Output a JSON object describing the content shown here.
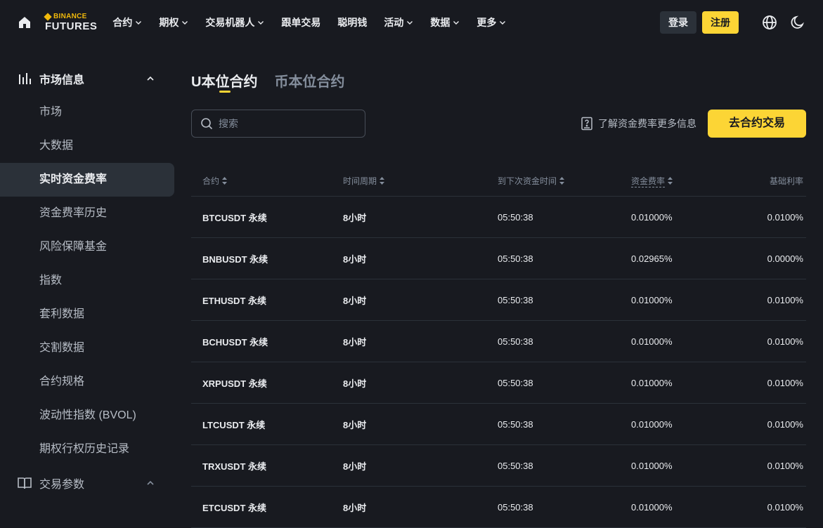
{
  "header": {
    "logo_top": "BINANCE",
    "logo_bottom": "FUTURES",
    "nav": [
      {
        "label": "合约",
        "dropdown": true
      },
      {
        "label": "期权",
        "dropdown": true
      },
      {
        "label": "交易机器人",
        "dropdown": true
      },
      {
        "label": "跟单交易",
        "dropdown": false
      },
      {
        "label": "聪明钱",
        "dropdown": false
      },
      {
        "label": "活动",
        "dropdown": true
      },
      {
        "label": "数据",
        "dropdown": true
      },
      {
        "label": "更多",
        "dropdown": true
      }
    ],
    "login_label": "登录",
    "register_label": "注册"
  },
  "sidebar": {
    "section1": "市场信息",
    "items": [
      "市场",
      "大数据",
      "实时资金费率",
      "资金费率历史",
      "风险保障基金",
      "指数",
      "套利数据",
      "交割数据",
      "合约规格",
      "波动性指数 (BVOL)",
      "期权行权历史记录"
    ],
    "active_index": 2,
    "section2": "交易参数"
  },
  "main": {
    "tabs": [
      "U本位合约",
      "币本位合约"
    ],
    "search_placeholder": "搜索",
    "info_link": "了解资金费率更多信息",
    "trade_button": "去合约交易",
    "columns": [
      "合约",
      "时间周期",
      "到下次资金时间",
      "资金费率",
      "基础利率"
    ],
    "rows": [
      [
        "BTCUSDT 永续",
        "8小时",
        "05:50:38",
        "0.01000%",
        "0.0100%"
      ],
      [
        "BNBUSDT 永续",
        "8小时",
        "05:50:38",
        "0.02965%",
        "0.0000%"
      ],
      [
        "ETHUSDT 永续",
        "8小时",
        "05:50:38",
        "0.01000%",
        "0.0100%"
      ],
      [
        "BCHUSDT 永续",
        "8小时",
        "05:50:38",
        "0.01000%",
        "0.0100%"
      ],
      [
        "XRPUSDT 永续",
        "8小时",
        "05:50:38",
        "0.01000%",
        "0.0100%"
      ],
      [
        "LTCUSDT 永续",
        "8小时",
        "05:50:38",
        "0.01000%",
        "0.0100%"
      ],
      [
        "TRXUSDT 永续",
        "8小时",
        "05:50:38",
        "0.01000%",
        "0.0100%"
      ],
      [
        "ETCUSDT 永续",
        "8小时",
        "05:50:38",
        "0.01000%",
        "0.0100%"
      ]
    ]
  },
  "colors": {
    "accent": "#fcd535",
    "background": "#181a20",
    "surface": "#2b3139",
    "muted": "#848e9c"
  },
  "icons": {
    "home": "home-icon",
    "globe": "globe-icon",
    "theme": "moon-icon",
    "market": "bar-chart-icon",
    "params": "book-icon",
    "search": "search-icon",
    "info": "question-doc-icon"
  }
}
